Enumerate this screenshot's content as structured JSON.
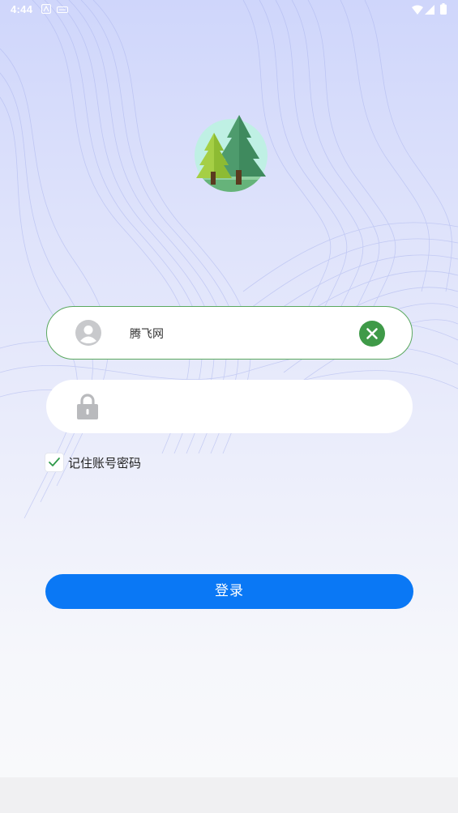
{
  "status_bar": {
    "time": "4:44"
  },
  "login": {
    "username_value": "腾飞网",
    "password_value": "",
    "remember_label": "记住账号密码",
    "remember_checked": true,
    "login_button_label": "登录"
  },
  "colors": {
    "accent": "#0a78f5",
    "clear_button": "#3f9a48",
    "field_border_active": "#5aa85f",
    "check_mark": "#2f9a4a"
  },
  "icons": {
    "avatar": "user-avatar-icon",
    "clear": "close-circle-icon",
    "lock": "lock-icon",
    "logo": "forest-tree-logo"
  }
}
